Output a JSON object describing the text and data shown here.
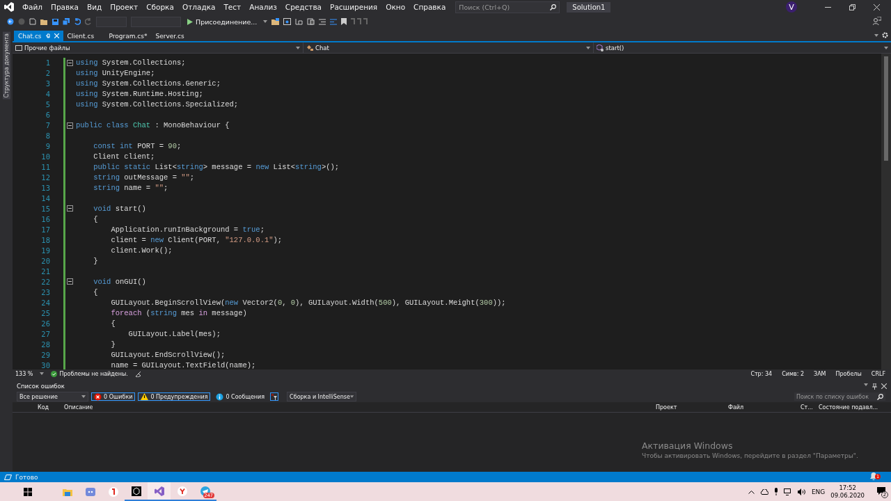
{
  "menu": {
    "items": [
      "Файл",
      "Правка",
      "Вид",
      "Проект",
      "Сборка",
      "Отладка",
      "Тест",
      "Анализ",
      "Средства",
      "Расширения",
      "Окно",
      "Справка"
    ],
    "search": {
      "placeholder": "Поиск (Ctrl+Q)"
    },
    "solution": "Solution1",
    "avatar": "V"
  },
  "toolbar": {
    "run_button": "Присоединение..."
  },
  "side_panel": "Структура документа",
  "tabs": [
    {
      "label": "Chat.cs",
      "selected": true
    },
    {
      "label": "Client.cs",
      "selected": false
    },
    {
      "label": "Program.cs*",
      "selected": false
    },
    {
      "label": "Server.cs",
      "selected": false
    }
  ],
  "nav": {
    "project": "Прочие файлы",
    "type": "Chat",
    "member": "start()"
  },
  "code": [
    {
      "n": "1",
      "fold": true,
      "tokens": [
        {
          "kind": "kw",
          "text": "using"
        },
        {
          "kind": "p",
          "text": " System.Collections;"
        }
      ]
    },
    {
      "n": "2",
      "fold": false,
      "tokens": [
        {
          "kind": "kw",
          "text": "using"
        },
        {
          "kind": "p",
          "text": " UnityEngine;"
        }
      ]
    },
    {
      "n": "3",
      "fold": false,
      "tokens": [
        {
          "kind": "kw",
          "text": "using"
        },
        {
          "kind": "p",
          "text": " System.Collections.Generic;"
        }
      ]
    },
    {
      "n": "4",
      "fold": false,
      "tokens": [
        {
          "kind": "kw",
          "text": "using"
        },
        {
          "kind": "p",
          "text": " System.Runtime.Hosting;"
        }
      ]
    },
    {
      "n": "5",
      "fold": false,
      "tokens": [
        {
          "kind": "kw",
          "text": "using"
        },
        {
          "kind": "p",
          "text": " System.Collections.Specialized;"
        }
      ]
    },
    {
      "n": "6",
      "fold": false
    },
    {
      "n": "7",
      "fold": true,
      "tokens": [
        {
          "kind": "kw",
          "text": "public class"
        },
        {
          "kind": "type",
          "text": " Chat"
        },
        {
          "kind": "p",
          "text": " : MonoBehaviour {"
        }
      ]
    },
    {
      "n": "8",
      "fold": false
    },
    {
      "n": "9",
      "fold": false,
      "tokens": [
        {
          "kind": "kw",
          "text": "    const int"
        },
        {
          "kind": "p",
          "text": " PORT = "
        },
        {
          "kind": "num",
          "text": "90"
        },
        {
          "kind": "p",
          "text": ";"
        }
      ]
    },
    {
      "n": "10",
      "fold": false,
      "tokens": [
        {
          "kind": "p",
          "text": "    Client client;"
        }
      ]
    },
    {
      "n": "11",
      "fold": false,
      "tokens": [
        {
          "kind": "kw",
          "text": "    public static"
        },
        {
          "kind": "p",
          "text": " List<"
        },
        {
          "kind": "kw",
          "text": "string"
        },
        {
          "kind": "p",
          "text": "> message = "
        },
        {
          "kind": "kw",
          "text": "new"
        },
        {
          "kind": "p",
          "text": " List<"
        },
        {
          "kind": "kw",
          "text": "string"
        },
        {
          "kind": "p",
          "text": ">();"
        }
      ]
    },
    {
      "n": "12",
      "fold": false,
      "tokens": [
        {
          "kind": "kw",
          "text": "    string"
        },
        {
          "kind": "p",
          "text": " outMessage = "
        },
        {
          "kind": "str",
          "text": "\"\""
        },
        {
          "kind": "p",
          "text": ";"
        }
      ]
    },
    {
      "n": "13",
      "fold": false,
      "tokens": [
        {
          "kind": "kw",
          "text": "    string"
        },
        {
          "kind": "p",
          "text": " name = "
        },
        {
          "kind": "str",
          "text": "\"\""
        },
        {
          "kind": "p",
          "text": ";"
        }
      ]
    },
    {
      "n": "14",
      "fold": false
    },
    {
      "n": "15",
      "fold": true,
      "tokens": [
        {
          "kind": "kw",
          "text": "    void"
        },
        {
          "kind": "p",
          "text": " start()"
        }
      ]
    },
    {
      "n": "16",
      "fold": false,
      "tokens": [
        {
          "kind": "p",
          "text": "    {"
        }
      ]
    },
    {
      "n": "17",
      "fold": false,
      "tokens": [
        {
          "kind": "p",
          "text": "        Application.runInBackground = "
        },
        {
          "kind": "kw",
          "text": "true"
        },
        {
          "kind": "p",
          "text": ";"
        }
      ]
    },
    {
      "n": "18",
      "fold": false,
      "tokens": [
        {
          "kind": "p",
          "text": "        client = "
        },
        {
          "kind": "kw",
          "text": "new"
        },
        {
          "kind": "p",
          "text": " Client(PORT, "
        },
        {
          "kind": "str",
          "text": "\"127.0.0.1\""
        },
        {
          "kind": "p",
          "text": ");"
        }
      ]
    },
    {
      "n": "19",
      "fold": false,
      "tokens": [
        {
          "kind": "p",
          "text": "        client.Work();"
        }
      ]
    },
    {
      "n": "20",
      "fold": false,
      "tokens": [
        {
          "kind": "p",
          "text": "    }"
        }
      ]
    },
    {
      "n": "21",
      "fold": false
    },
    {
      "n": "22",
      "fold": true,
      "tokens": [
        {
          "kind": "kw",
          "text": "    void"
        },
        {
          "kind": "p",
          "text": " onGUI()"
        }
      ]
    },
    {
      "n": "23",
      "fold": false,
      "tokens": [
        {
          "kind": "p",
          "text": "    {"
        }
      ]
    },
    {
      "n": "24",
      "fold": false,
      "tokens": [
        {
          "kind": "p",
          "text": "        GUILayout.BeginScrollView("
        },
        {
          "kind": "kw",
          "text": "new"
        },
        {
          "kind": "p",
          "text": " Vector2("
        },
        {
          "kind": "num",
          "text": "0"
        },
        {
          "kind": "p",
          "text": ", "
        },
        {
          "kind": "num",
          "text": "0"
        },
        {
          "kind": "p",
          "text": "), GUILayout.Width("
        },
        {
          "kind": "num",
          "text": "500"
        },
        {
          "kind": "p",
          "text": "), GUILayout.Meight("
        },
        {
          "kind": "num",
          "text": "300"
        },
        {
          "kind": "p",
          "text": "));"
        }
      ]
    },
    {
      "n": "25",
      "fold": false,
      "tokens": [
        {
          "kind": "ctl",
          "text": "        foreach"
        },
        {
          "kind": "p",
          "text": " ("
        },
        {
          "kind": "kw",
          "text": "string"
        },
        {
          "kind": "p",
          "text": " mes "
        },
        {
          "kind": "ctl",
          "text": "in"
        },
        {
          "kind": "p",
          "text": " message)"
        }
      ]
    },
    {
      "n": "26",
      "fold": false,
      "tokens": [
        {
          "kind": "p",
          "text": "        {"
        }
      ]
    },
    {
      "n": "27",
      "fold": false,
      "tokens": [
        {
          "kind": "p",
          "text": "            GUILayout.Label(mes);"
        }
      ]
    },
    {
      "n": "28",
      "fold": false,
      "tokens": [
        {
          "kind": "p",
          "text": "        }"
        }
      ]
    },
    {
      "n": "29",
      "fold": false,
      "tokens": [
        {
          "kind": "p",
          "text": "        GUILayout.EndScrollView();"
        }
      ]
    },
    {
      "n": "30",
      "fold": false,
      "tokens": [
        {
          "kind": "p",
          "text": "        name = GUILayout.TextField(name);"
        }
      ]
    }
  ],
  "editor_status": {
    "zoom": "133 %",
    "issues": "Проблемы не найдены.",
    "line": "Стр: 34",
    "col": "Симв: 2",
    "mode": "ЗАМ",
    "spaces": "Пробелы",
    "eol": "CRLF"
  },
  "error_list": {
    "title": "Список ошибок",
    "scope": "Все решение",
    "filters": [
      {
        "kind": "error",
        "label": "0 Ошибки",
        "selected": true
      },
      {
        "kind": "warning",
        "label": "0 Предупреждения",
        "selected": true
      },
      {
        "kind": "info",
        "label": "0 Сообщения",
        "selected": false
      }
    ],
    "source": "Сборка и IntelliSense",
    "search": {
      "placeholder": "Поиск по списку ошибок"
    },
    "columns": [
      "Код",
      "Описание",
      "Проект",
      "Файл",
      "Ст...",
      "Состояние подавл..."
    ]
  },
  "activation": {
    "title": "Активация Windows",
    "text": "Чтобы активировать Windows, перейдите в раздел \"Параметры\"."
  },
  "status_bar": {
    "text": "Готово",
    "notifications": "1"
  },
  "taskbar": {
    "telegram_badge": "247",
    "language": "ENG",
    "time": "17:52",
    "date": "09.06.2020",
    "action_center": "2"
  }
}
